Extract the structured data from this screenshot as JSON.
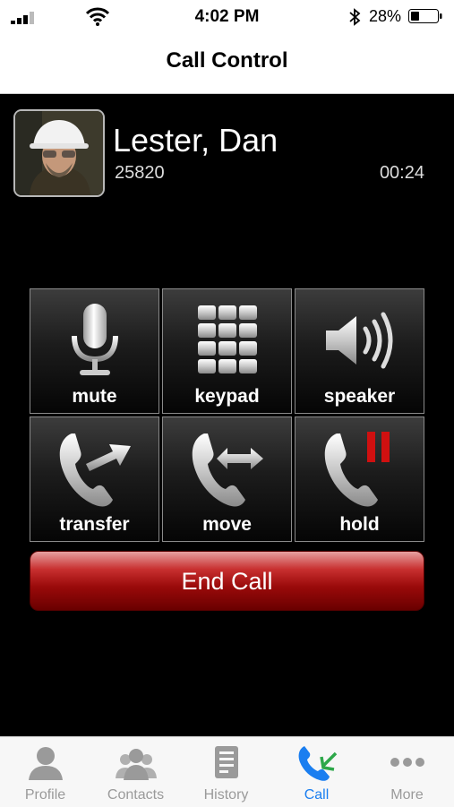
{
  "status_bar": {
    "time": "4:02 PM",
    "battery": "28%"
  },
  "nav": {
    "title": "Call Control"
  },
  "caller": {
    "name": "Lester, Dan",
    "extension": "25820",
    "duration": "00:24"
  },
  "controls": [
    {
      "label": "mute",
      "icon": "microphone-icon"
    },
    {
      "label": "keypad",
      "icon": "keypad-icon"
    },
    {
      "label": "speaker",
      "icon": "speaker-icon"
    },
    {
      "label": "transfer",
      "icon": "transfer-icon"
    },
    {
      "label": "move",
      "icon": "move-icon"
    },
    {
      "label": "hold",
      "icon": "hold-icon"
    }
  ],
  "end_call": {
    "label": "End Call",
    "color": "#b01010"
  },
  "tabs": [
    {
      "label": "Profile",
      "icon": "person-icon",
      "active": false
    },
    {
      "label": "Contacts",
      "icon": "contacts-icon",
      "active": false
    },
    {
      "label": "History",
      "icon": "history-icon",
      "active": false
    },
    {
      "label": "Call",
      "icon": "phone-icon",
      "active": true
    },
    {
      "label": "More",
      "icon": "more-icon",
      "active": false
    }
  ],
  "colors": {
    "active_tab": "#1a7ef0",
    "inactive_tab": "#9a9a9a"
  }
}
